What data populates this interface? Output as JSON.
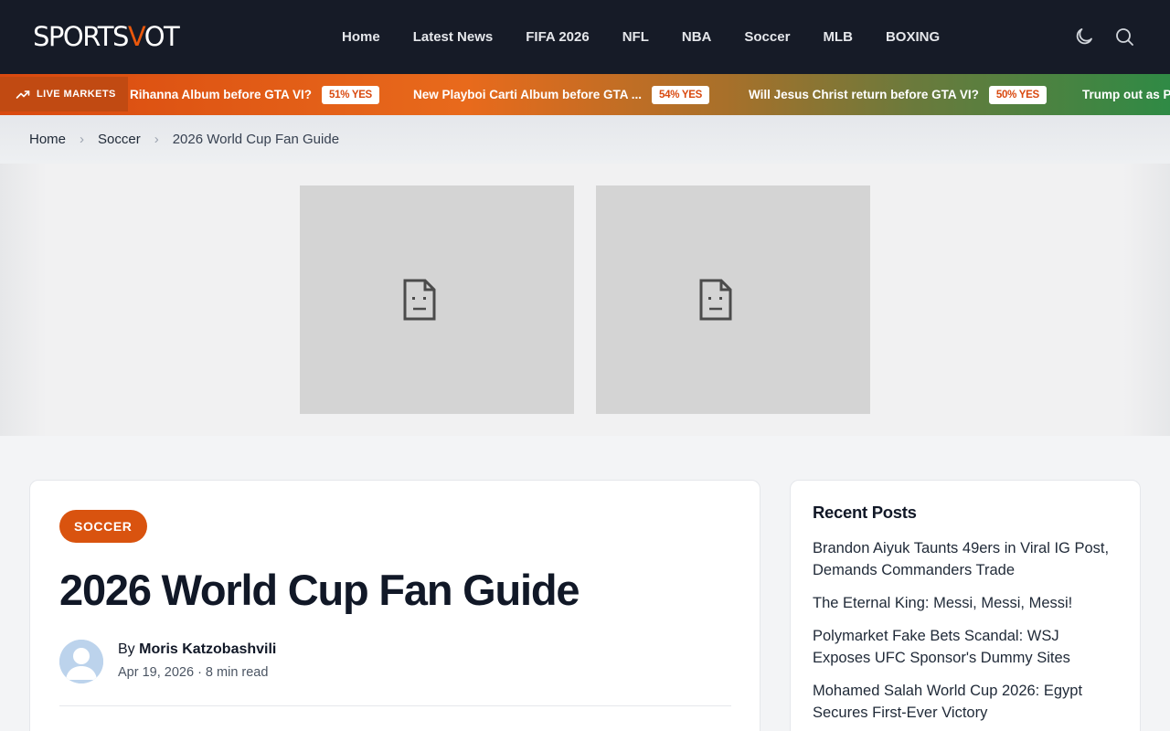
{
  "header": {
    "logo_prefix": "SPORTS",
    "logo_accent": "V",
    "logo_suffix": "OT",
    "nav": [
      "Home",
      "Latest News",
      "FIFA 2026",
      "NFL",
      "NBA",
      "Soccer",
      "MLB",
      "BOXING"
    ],
    "icons": [
      "moon-icon",
      "search-icon"
    ]
  },
  "ticker": {
    "label": "LIVE MARKETS",
    "items": [
      {
        "question": "Rihanna Album before GTA VI?",
        "odds": "51% YES"
      },
      {
        "question": "New Playboi Carti Album before GTA ...",
        "odds": "54% YES"
      },
      {
        "question": "Will Jesus Christ return before GTA VI?",
        "odds": "50% YES"
      },
      {
        "question": "Trump out as P",
        "odds": ""
      }
    ]
  },
  "breadcrumb": {
    "items": [
      "Home",
      "Soccer"
    ],
    "current": "2026 World Cup Fan Guide"
  },
  "article": {
    "category": "SOCCER",
    "title": "2026 World Cup Fan Guide",
    "by_prefix": "By",
    "author": "Moris Katzobashvili",
    "meta": "Apr 19, 2026 · 8 min read"
  },
  "sidebar": {
    "title": "Recent Posts",
    "posts": [
      "Brandon Aiyuk Taunts 49ers in Viral IG Post, Demands Commanders Trade",
      "The Eternal King: Messi, Messi, Messi!",
      "Polymarket Fake Bets Scandal: WSJ Exposes UFC Sponsor's Dummy Sites",
      "Mohamed Salah World Cup 2026: Egypt Secures First-Ever Victory"
    ]
  },
  "colors": {
    "header_bg": "#161b27",
    "accent": "#ea580c",
    "category_badge": "#d9530f"
  }
}
